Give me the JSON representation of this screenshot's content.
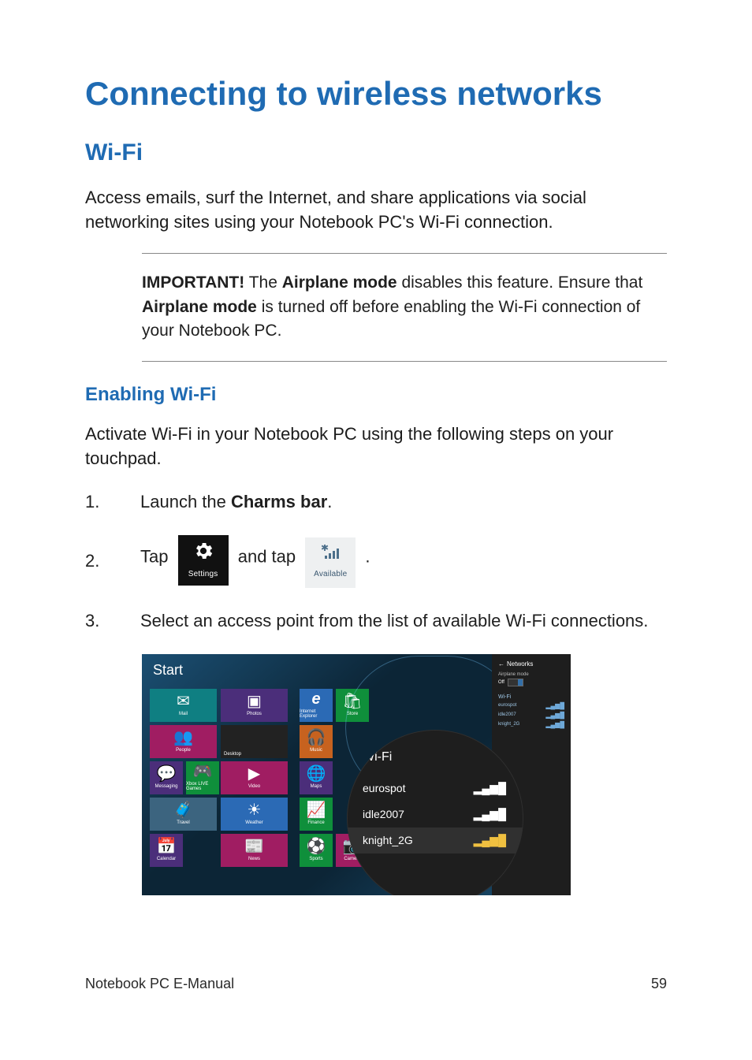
{
  "title": "Connecting to wireless networks",
  "section_wifi_heading": "Wi-Fi",
  "intro": "Access emails, surf the Internet, and share applications via social networking sites using your Notebook PC's Wi-Fi connection.",
  "note": {
    "label": "IMPORTANT!",
    "pre": " The ",
    "term1": "Airplane mode",
    "mid1": " disables this feature. Ensure that ",
    "term2": "Airplane mode",
    "post": " is turned off before enabling the Wi-Fi connection of your Notebook PC."
  },
  "enabling_heading": "Enabling Wi-Fi",
  "enabling_intro": "Activate Wi-Fi in your Notebook PC using the following steps on your touchpad.",
  "steps": {
    "n1": "1.",
    "s1_pre": "Launch the ",
    "s1_bold": "Charms bar",
    "s1_post": ".",
    "n2": "2.",
    "s2_pre": "Tap ",
    "s2_mid": " and tap ",
    "s2_post": ".",
    "settings_tile_label": "Settings",
    "available_tile_label": "Available",
    "n3": "3.",
    "s3": "Select an access point from the list of available Wi-Fi connections."
  },
  "figure": {
    "start_label": "Start",
    "tiles": {
      "mail": "Mail",
      "photos": "Photos",
      "ie": "Internet Explorer",
      "store": "Store",
      "people": "People",
      "desktop": "Desktop",
      "music": "Music",
      "messaging": "Messaging",
      "games": "Xbox LIVE Games",
      "video": "Video",
      "maps": "Maps",
      "travel": "Travel",
      "weather": "Weather",
      "finance": "Finance",
      "calendar": "Calendar",
      "news": "News",
      "sports": "Sports",
      "camera": "Camera"
    },
    "networks_panel": {
      "title": "Networks",
      "airplane_label": "Airplane mode",
      "airplane_state": "Off",
      "wifi_section": "Wi-Fi",
      "items": [
        "eurospot",
        "idle2007",
        "knight_2G"
      ]
    },
    "zoom": {
      "header": "Wi-Fi",
      "rows": [
        "eurospot",
        "idle2007",
        "knight_2G"
      ]
    }
  },
  "footer": {
    "left": "Notebook PC E-Manual",
    "right": "59"
  }
}
